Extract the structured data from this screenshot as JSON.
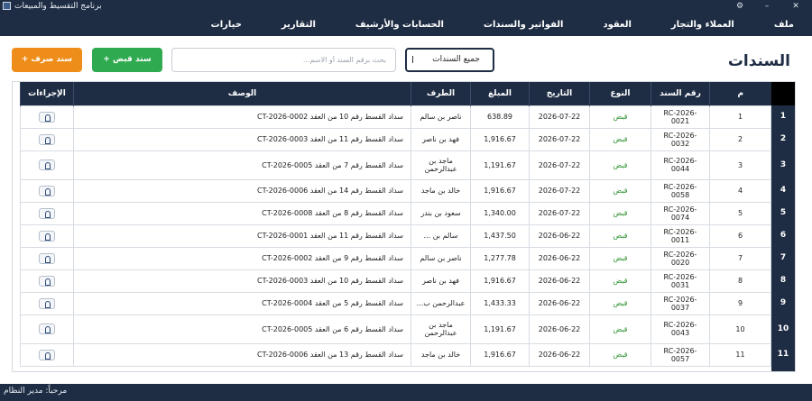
{
  "window": {
    "title": "برنامج التقسيط والمبيعات",
    "settings_glyph": "⚙",
    "minimize_glyph": "–",
    "maximize_glyph": "□",
    "close_glyph": "✕"
  },
  "menu": [
    "ملف",
    "العملاء والتجار",
    "العقود",
    "الفواتير والسندات",
    "الحسابات والأرشيف",
    "التقارير",
    "خيارات"
  ],
  "page": {
    "title": "السندات",
    "filter_value": "جميع السندات",
    "search_placeholder": "بحث برقم السند أو الاسم...",
    "receipt_button": "سند قبض +",
    "payment_button": "سند صرف +"
  },
  "table": {
    "columns": [
      "م",
      "رقم السند",
      "النوع",
      "التاريخ",
      "المبلغ",
      "الطرف",
      "الوصف",
      "الإجراءات"
    ],
    "rows": [
      {
        "n": "1",
        "no": "RC-2026-0021",
        "type": "قبض",
        "date": "2026-07-22",
        "amount": "638.89",
        "party": "ناصر بن سالم",
        "desc": "سداد القسط رقم 10 من العقد CT-2026-0002"
      },
      {
        "n": "2",
        "no": "RC-2026-0032",
        "type": "قبض",
        "date": "2026-07-22",
        "amount": "1,916.67",
        "party": "فهد بن ناصر",
        "desc": "سداد القسط رقم 11 من العقد CT-2026-0003"
      },
      {
        "n": "3",
        "no": "RC-2026-0044",
        "type": "قبض",
        "date": "2026-07-22",
        "amount": "1,191.67",
        "party": "ماجد بن عبدالرحمن",
        "desc": "سداد القسط رقم 7 من العقد CT-2026-0005"
      },
      {
        "n": "4",
        "no": "RC-2026-0058",
        "type": "قبض",
        "date": "2026-07-22",
        "amount": "1,916.67",
        "party": "خالد بن ماجد",
        "desc": "سداد القسط رقم 14 من العقد CT-2026-0006"
      },
      {
        "n": "5",
        "no": "RC-2026-0074",
        "type": "قبض",
        "date": "2026-07-22",
        "amount": "1,340.00",
        "party": "سعود بن بندر",
        "desc": "سداد القسط رقم 8 من العقد CT-2026-0008"
      },
      {
        "n": "6",
        "no": "RC-2026-0011",
        "type": "قبض",
        "date": "2026-06-22",
        "amount": "1,437.50",
        "party": "سالم بن ...",
        "desc": "سداد القسط رقم 11 من العقد CT-2026-0001"
      },
      {
        "n": "7",
        "no": "RC-2026-0020",
        "type": "قبض",
        "date": "2026-06-22",
        "amount": "1,277.78",
        "party": "ناصر بن سالم",
        "desc": "سداد القسط رقم 9 من العقد CT-2026-0002"
      },
      {
        "n": "8",
        "no": "RC-2026-0031",
        "type": "قبض",
        "date": "2026-06-22",
        "amount": "1,916.67",
        "party": "فهد بن ناصر",
        "desc": "سداد القسط رقم 10 من العقد CT-2026-0003"
      },
      {
        "n": "9",
        "no": "RC-2026-0037",
        "type": "قبض",
        "date": "2026-06-22",
        "amount": "1,433.33",
        "party": "عبدالرحمن ب...",
        "desc": "سداد القسط رقم 5 من العقد CT-2026-0004"
      },
      {
        "n": "10",
        "no": "RC-2026-0043",
        "type": "قبض",
        "date": "2026-06-22",
        "amount": "1,191.67",
        "party": "ماجد بن عبدالرحمن",
        "desc": "سداد القسط رقم 6 من العقد CT-2026-0005"
      },
      {
        "n": "11",
        "no": "RC-2026-0057",
        "type": "قبض",
        "date": "2026-06-22",
        "amount": "1,916.67",
        "party": "خالد بن ماجد",
        "desc": "سداد القسط رقم 13 من العقد CT-2026-0006"
      }
    ]
  },
  "status": {
    "text": "مرحباً: مدير النظام"
  }
}
